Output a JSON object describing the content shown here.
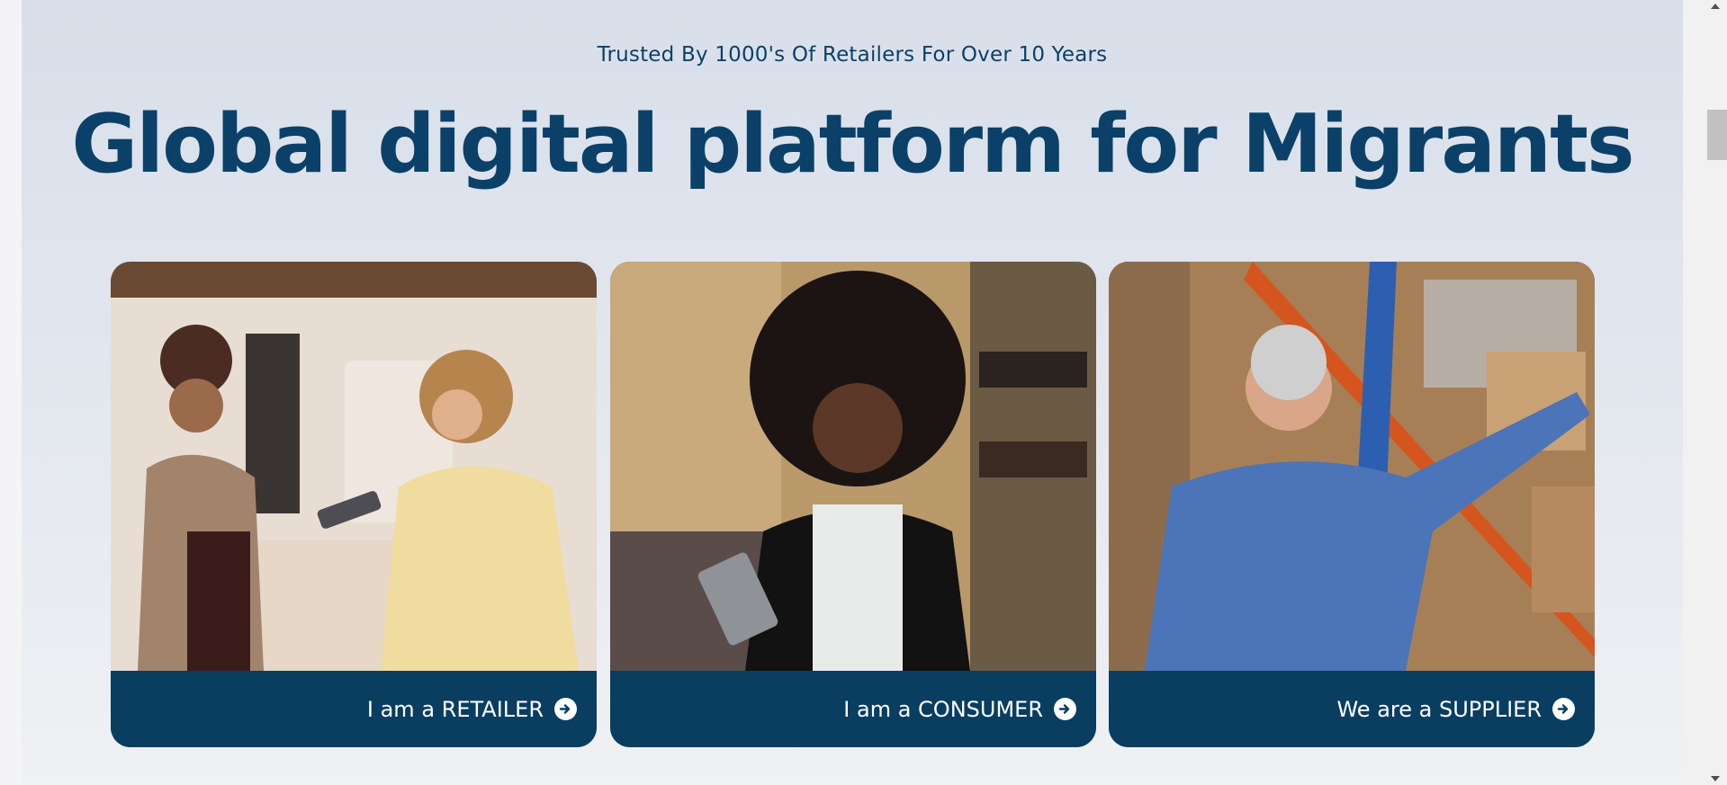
{
  "hero": {
    "tagline": "Trusted By 1000's Of Retailers For Over 10 Years",
    "headline": "Global digital platform for Migrants"
  },
  "cards": [
    {
      "label": "I am a RETAILER",
      "icon": "arrow-right-circle-icon"
    },
    {
      "label": "I am a CONSUMER",
      "icon": "arrow-right-circle-icon"
    },
    {
      "label": "We are a SUPPLIER",
      "icon": "arrow-right-circle-icon"
    }
  ],
  "colors": {
    "brand_navy": "#0b4169",
    "card_footer": "#093e61",
    "page_background": "#dde3ec"
  }
}
